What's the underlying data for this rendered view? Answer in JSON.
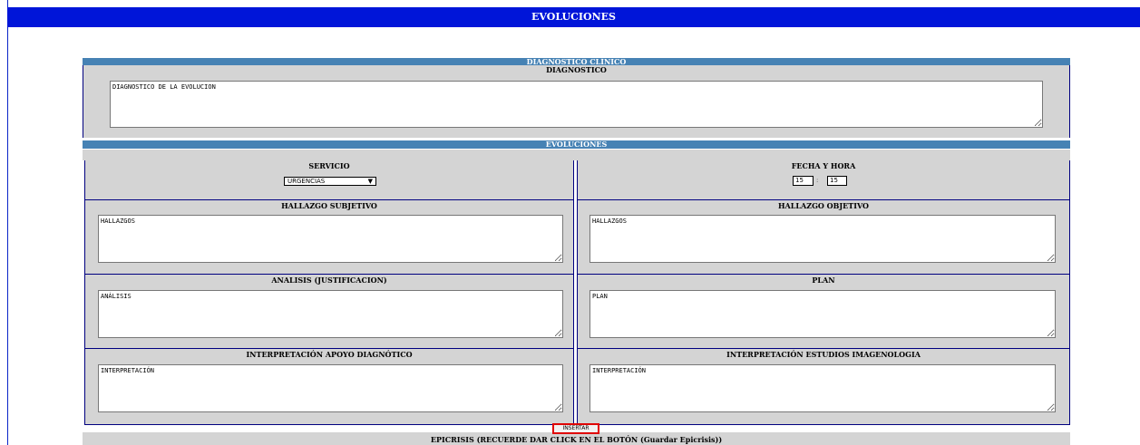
{
  "header": {
    "title": "EVOLUCIONES"
  },
  "diagnostico": {
    "section_title": "DIAGNOSTICO CLÍNICO",
    "label": "DIAGNOSTICO",
    "value": "DIAGNOSTICO DE LA EVOLUCION"
  },
  "evoluciones": {
    "section_title": "EVOLUCIONES",
    "servicio": {
      "label": "SERVICIO",
      "selected": "URGENCIAS"
    },
    "fecha_hora": {
      "label": "FECHA Y HORA",
      "hour": "15",
      "separator": ":",
      "minute": "15"
    },
    "hallazgo_subjetivo": {
      "label": "HALLAZGO SUBJETIVO",
      "value": "HALLAZGOS"
    },
    "hallazgo_objetivo": {
      "label": "HALLAZGO OBJETIVO",
      "value": "HALLAZGOS"
    },
    "analisis": {
      "label": "ANALISIS (JUSTIFICACION)",
      "value": "ANÁLISIS"
    },
    "plan": {
      "label": "PLAN",
      "value": "PLAN"
    },
    "interp_apoyo": {
      "label": "INTERPRETACIÓN APOYO DIAGNÓTICO",
      "value": "INTERPRETACIÓN"
    },
    "interp_imagen": {
      "label": "INTERPRETACIÓN ESTUDIOS IMAGENOLOGIA",
      "value": "INTERPRETACIÓN"
    },
    "insert_button": "INSERTAR"
  },
  "epicrisis": {
    "label": "EPICRISIS (RECUERDE DAR CLICK EN EL BOTÓN (Guardar Epicrisis))"
  }
}
